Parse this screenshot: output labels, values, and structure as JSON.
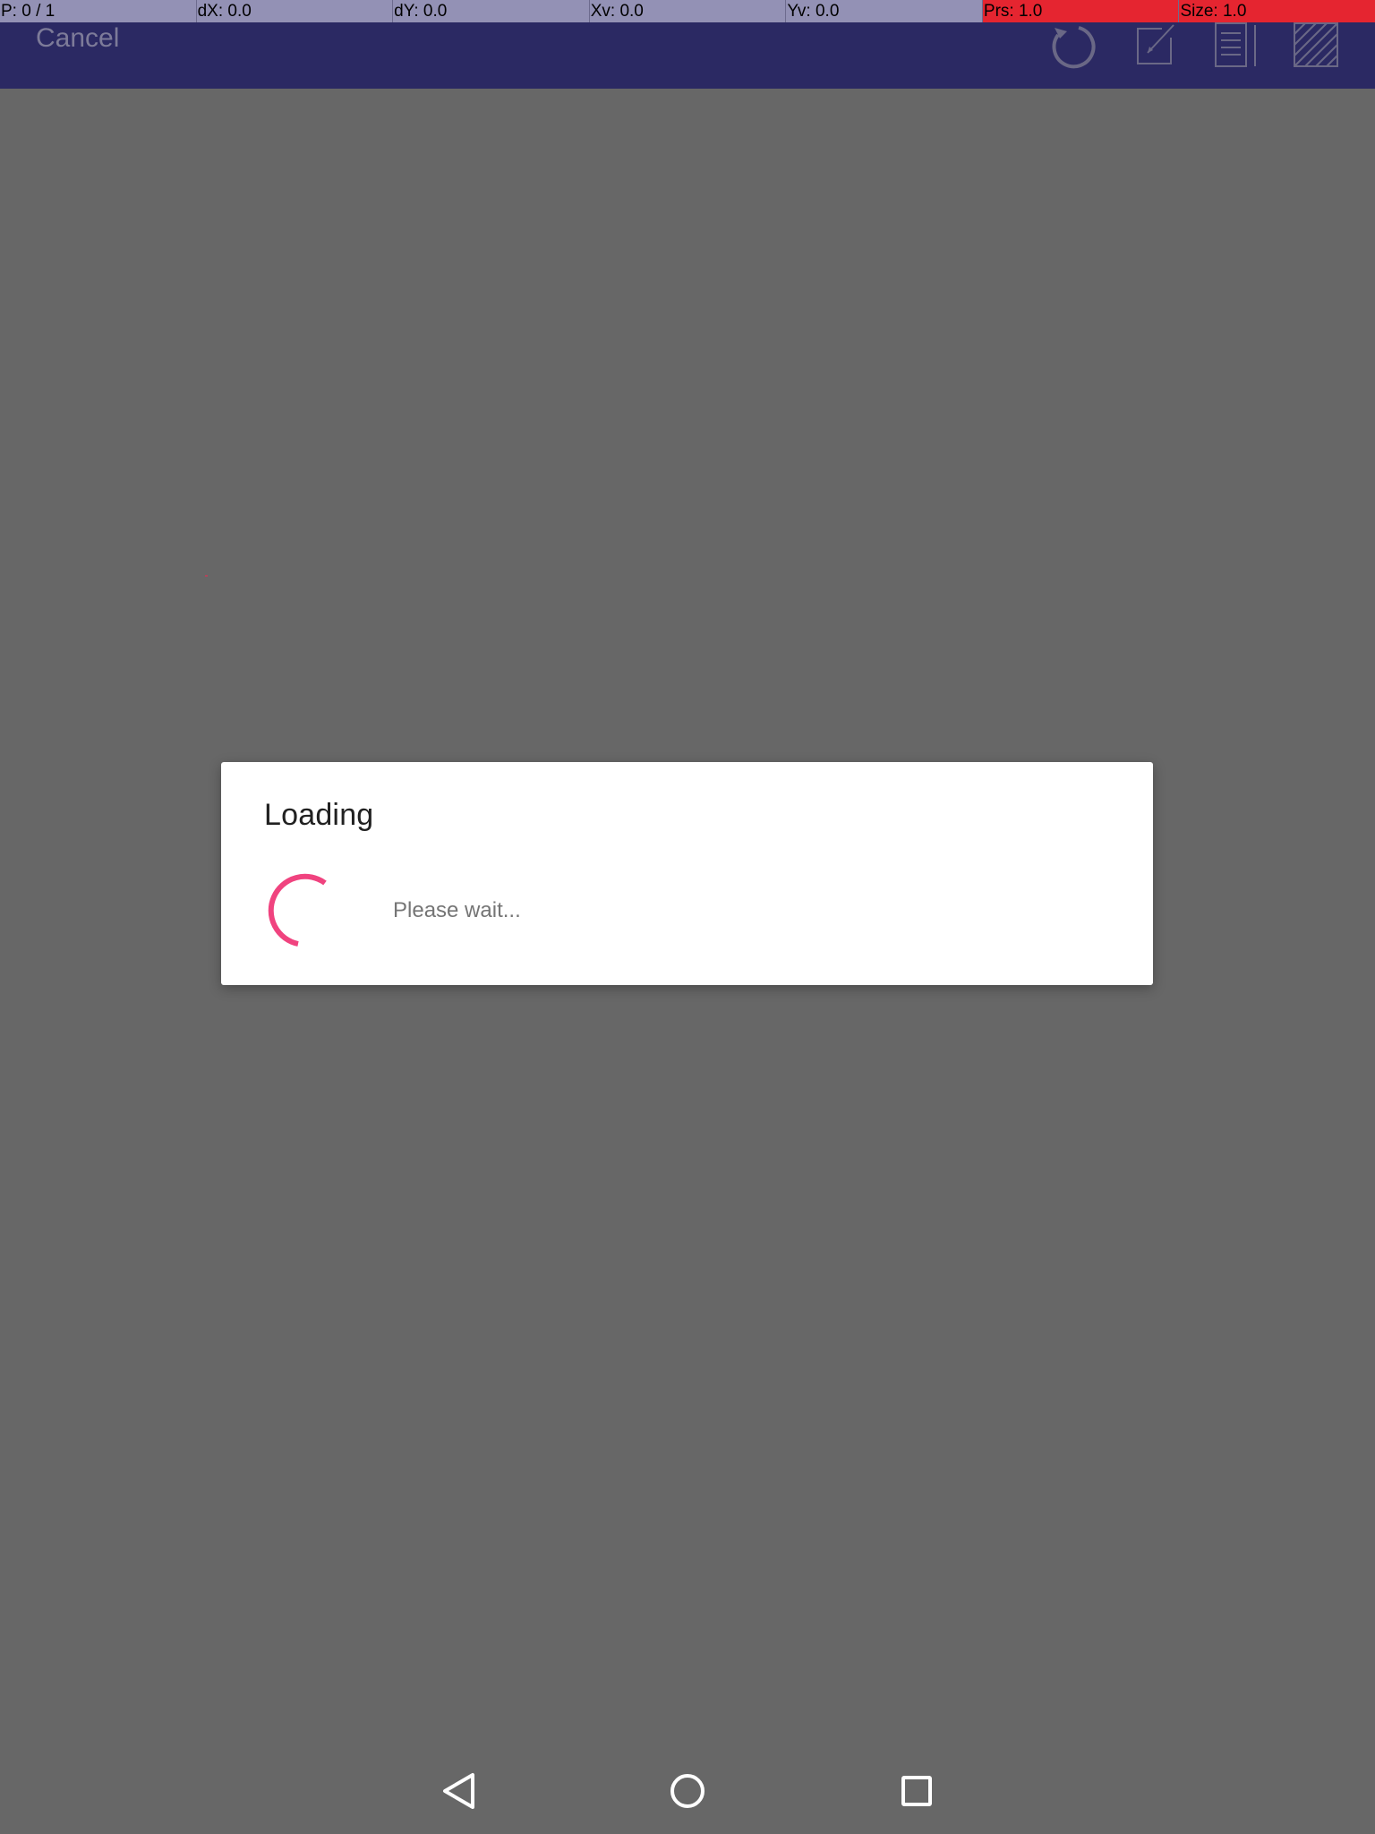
{
  "debug_bar": {
    "pointer": "P: 0 / 1",
    "dx": "dX: 0.0",
    "dy": "dY: 0.0",
    "xv": "Xv: 0.0",
    "yv": "Yv: 0.0",
    "pressure": "Prs: 1.0",
    "size": "Size: 1.0",
    "alert_color": "#e52530"
  },
  "toolbar": {
    "cancel_label": "Cancel",
    "icons": [
      "rotate-icon",
      "edit-icon",
      "document-icon",
      "hatch-pattern-icon"
    ],
    "background": "#2b2963"
  },
  "dialog": {
    "title": "Loading",
    "message": "Please wait...",
    "spinner_color": "#f0437f"
  },
  "navbar": {
    "icons": [
      "back-icon",
      "home-icon",
      "recents-icon"
    ]
  }
}
